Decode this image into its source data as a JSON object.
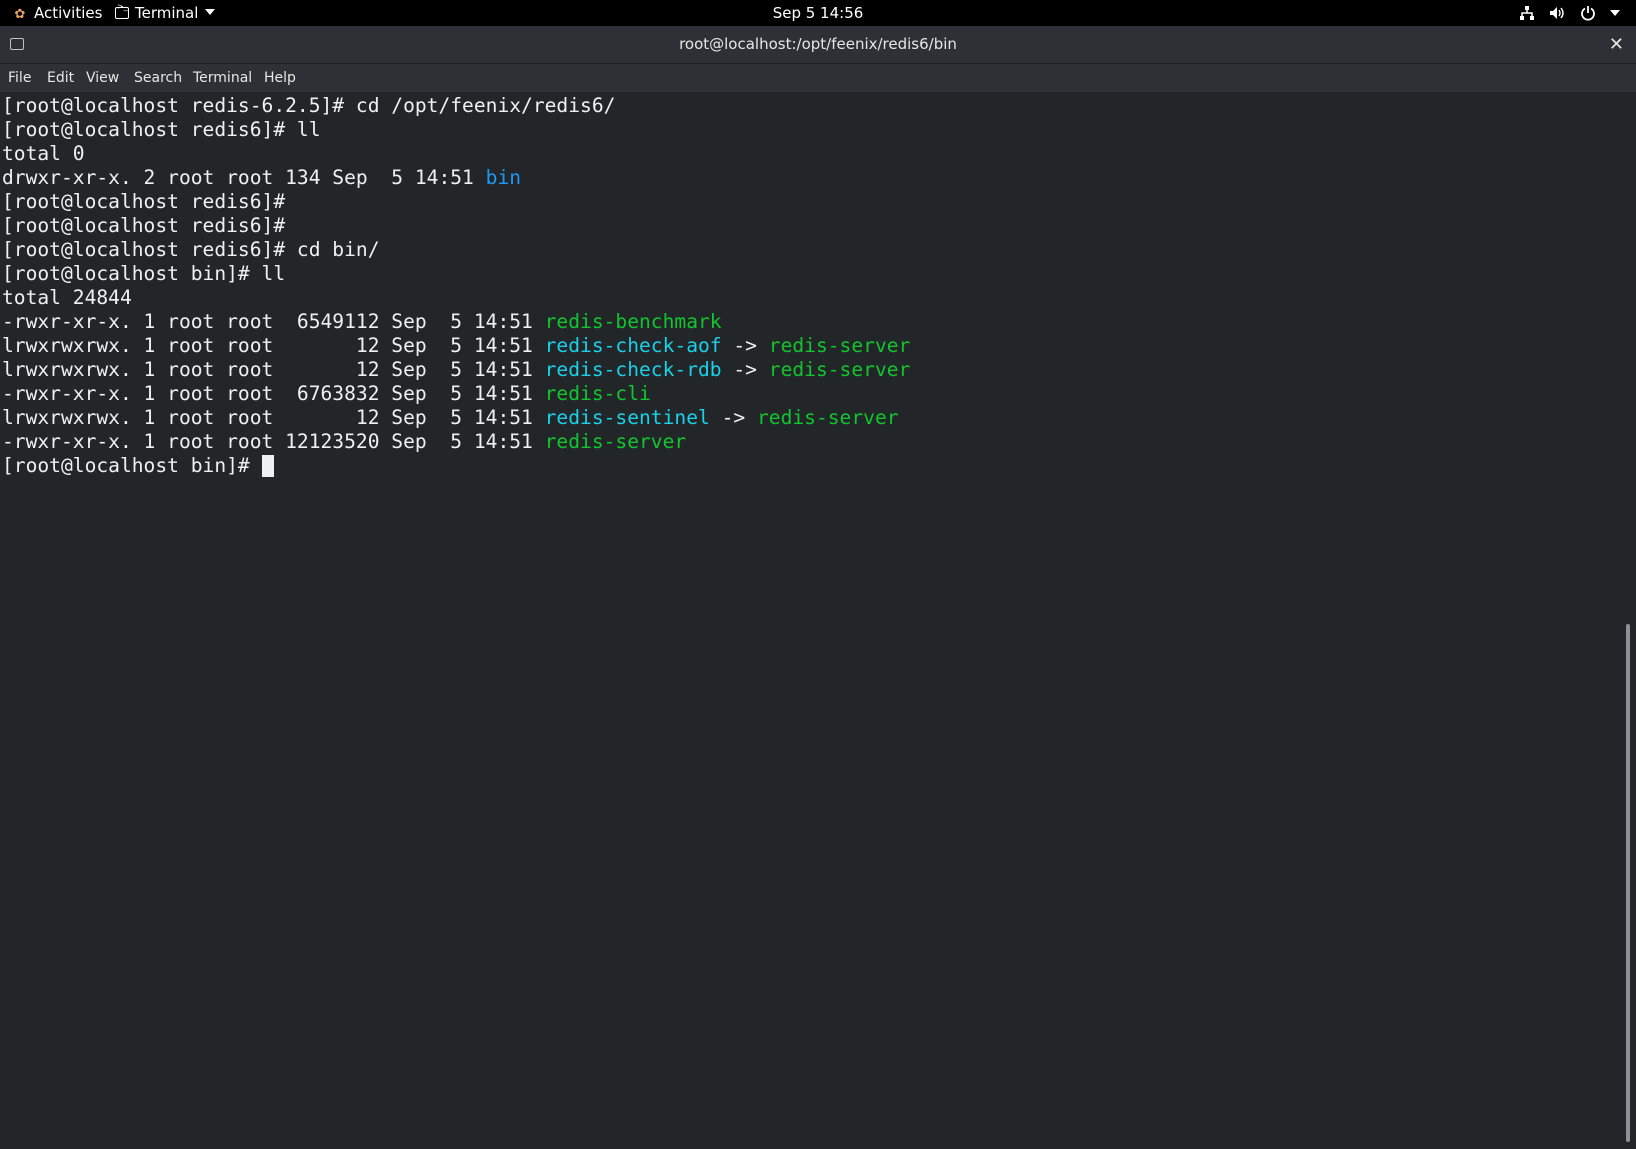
{
  "topbar": {
    "activities": "Activities",
    "app_name": "Terminal",
    "clock": "Sep 5  14:56"
  },
  "window": {
    "title": "root@localhost:/opt/feenix/redis6/bin",
    "close_glyph": "✕"
  },
  "menu": [
    "File",
    "Edit",
    "View",
    "Search",
    "Terminal",
    "Help"
  ],
  "terminal": {
    "lines": [
      "[root@localhost redis-6.2.5]# cd /opt/feenix/redis6/",
      "[root@localhost redis6]# ll",
      "total 0",
      "drwxr-xr-x. 2 root root 134 Sep  5 14:51 ",
      "[root@localhost redis6]#",
      "[root@localhost redis6]#",
      "[root@localhost redis6]# cd bin/",
      "[root@localhost bin]# ll",
      "total 24844"
    ],
    "dir_name": "bin",
    "listing": [
      {
        "meta": "-rwxr-xr-x. 1 root root  6549112 Sep  5 14:51 ",
        "name": "redis-benchmark",
        "kind": "exec",
        "arrow": "",
        "target": ""
      },
      {
        "meta": "lrwxrwxrwx. 1 root root       12 Sep  5 14:51 ",
        "name": "redis-check-aof",
        "kind": "link",
        "arrow": " -> ",
        "target": "redis-server"
      },
      {
        "meta": "lrwxrwxrwx. 1 root root       12 Sep  5 14:51 ",
        "name": "redis-check-rdb",
        "kind": "link",
        "arrow": " -> ",
        "target": "redis-server"
      },
      {
        "meta": "-rwxr-xr-x. 1 root root  6763832 Sep  5 14:51 ",
        "name": "redis-cli",
        "kind": "exec",
        "arrow": "",
        "target": ""
      },
      {
        "meta": "lrwxrwxrwx. 1 root root       12 Sep  5 14:51 ",
        "name": "redis-sentinel",
        "kind": "link",
        "arrow": " -> ",
        "target": "redis-server"
      },
      {
        "meta": "-rwxr-xr-x. 1 root root 12123520 Sep  5 14:51 ",
        "name": "redis-server",
        "kind": "exec",
        "arrow": "",
        "target": ""
      }
    ],
    "prompt": "[root@localhost bin]# "
  },
  "colors": {
    "background": "#232629",
    "foreground": "#eff0f1",
    "directory": "#1d99f3",
    "executable": "#11c52f",
    "symlink": "#1ad1e8"
  },
  "icons": {
    "activities": "gnome-foot-icon",
    "app": "terminal-icon",
    "network": "network-icon",
    "volume": "volume-icon",
    "power": "power-icon"
  }
}
